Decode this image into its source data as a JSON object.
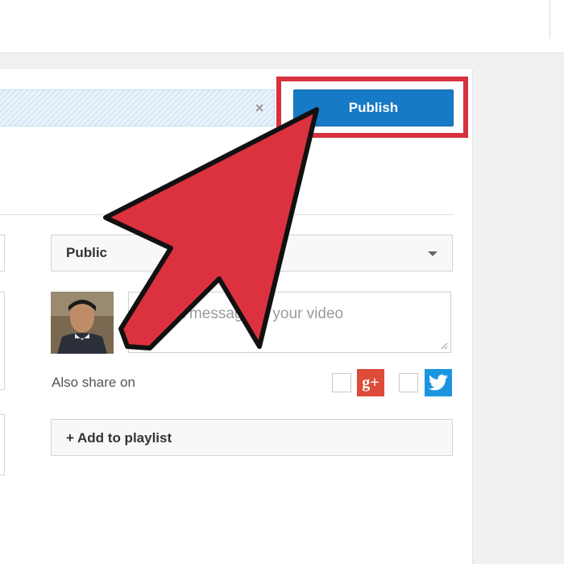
{
  "upload": {
    "close_glyph": "×",
    "publish_label": "Publish"
  },
  "sharing": {
    "privacy_selected": "Public",
    "message_placeholder": "Add a message to your video",
    "also_share_label": "Also share on",
    "gplus_glyph": "g+"
  },
  "playlist": {
    "add_label": "+ Add to playlist"
  },
  "colors": {
    "publish_blue": "#167ac6",
    "highlight_red": "#d7303f",
    "arrow_red": "#dc313f",
    "gplus_red": "#dd4b39",
    "twitter_blue": "#1b95e0"
  },
  "icons": [
    "close-icon",
    "chevron-down-icon",
    "google-plus-icon",
    "twitter-icon",
    "resize-grip-icon",
    "pointer-arrow-icon"
  ]
}
